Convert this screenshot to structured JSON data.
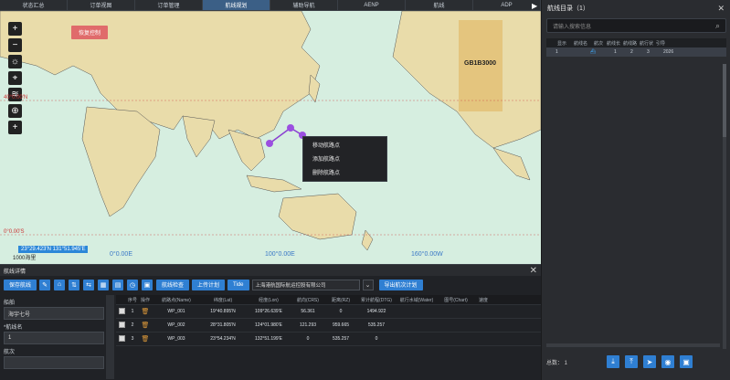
{
  "tabs": [
    "状态汇总",
    "订单视图",
    "订单管理",
    "航线规划",
    "辅助导航",
    "AENP",
    "航线",
    "ADP"
  ],
  "active_tab": 3,
  "map": {
    "alert_label": "恢复控制",
    "gb_label": "GB1B3000",
    "lon_labels": [
      "0°0.00E",
      "100°0.00E",
      "160°0.00W"
    ],
    "lat_top": "40°0.00'N",
    "lat_bottom": "0°0.00'S",
    "coord": "23°29.423'N 131°51.945'E",
    "scale": "1000海里",
    "context_menu": [
      "移动航路点",
      "添加航路点",
      "删除航路点"
    ]
  },
  "right_panel": {
    "title": "航线目录（1）",
    "search_placeholder": "请输入搜索信息",
    "columns": [
      "",
      "显示",
      "航线名",
      "航次",
      "航线长",
      "航线路",
      "航行状",
      "引导"
    ],
    "rows": [
      [
        "",
        "1",
        "",
        "",
        "",
        "1",
        "2",
        "3",
        "2026"
      ]
    ],
    "footer_count": "总数： 1"
  },
  "bottom": {
    "title": "航线详情",
    "buttons": {
      "save": "保存航线",
      "check": "航线检查",
      "upload": "上传计划",
      "tide": "Tide",
      "export": "导出航次计划"
    },
    "company": "上海港航国际航运控股有限公司",
    "form": {
      "vessel_label": "船舶",
      "vessel_value": "海宇七号",
      "route_label": "*航线名",
      "route_value": "1",
      "voyage_label": "航次"
    },
    "columns": [
      "",
      "序号",
      "操作",
      "航路点(Name)",
      "纬度(Lat)",
      "经度(Lon)",
      "航向(CRS)",
      "距离(RZ)",
      "累计航程(DTG)",
      "航行水域(Water)",
      "图号(Chart)",
      "速度"
    ],
    "rows": [
      [
        "",
        "1",
        "",
        "WP_001",
        "19°40.895'N",
        "109°26.639'E",
        "56.361",
        "0",
        "1494.922",
        "",
        "",
        ""
      ],
      [
        "",
        "2",
        "",
        "WP_002",
        "28°31.805'N",
        "124°01.980'E",
        "121.293",
        "959.665",
        "535.257",
        "",
        "",
        ""
      ],
      [
        "",
        "3",
        "",
        "WP_003",
        "23°54.234'N",
        "132°51.199'E",
        "0",
        "535.257",
        "0",
        "",
        "",
        ""
      ]
    ]
  }
}
